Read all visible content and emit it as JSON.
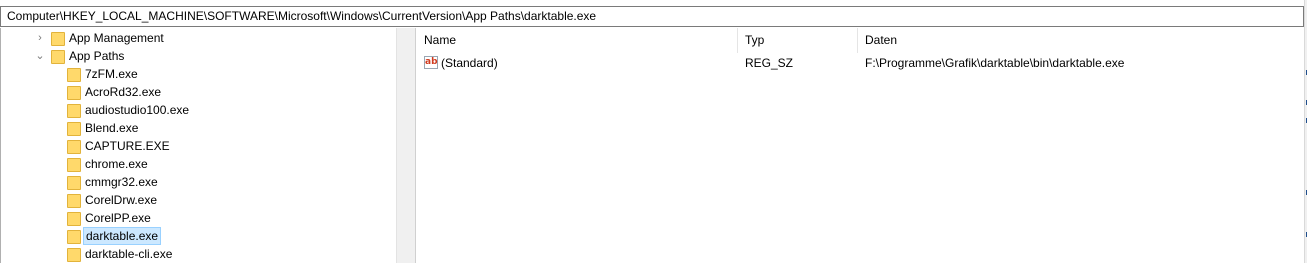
{
  "address_bar": {
    "path": "Computer\\HKEY_LOCAL_MACHINE\\SOFTWARE\\Microsoft\\Windows\\CurrentVersion\\App Paths\\darktable.exe"
  },
  "tree": {
    "parent_sibling": {
      "label": "App Management",
      "expanded": false
    },
    "parent": {
      "label": "App Paths",
      "expanded": true
    },
    "children": [
      {
        "label": "7zFM.exe"
      },
      {
        "label": "AcroRd32.exe"
      },
      {
        "label": "audiostudio100.exe"
      },
      {
        "label": "Blend.exe"
      },
      {
        "label": "CAPTURE.EXE"
      },
      {
        "label": "chrome.exe"
      },
      {
        "label": "cmmgr32.exe"
      },
      {
        "label": "CorelDrw.exe"
      },
      {
        "label": "CorelPP.exe"
      },
      {
        "label": "darktable.exe",
        "selected": true
      },
      {
        "label": "darktable-cli.exe"
      }
    ]
  },
  "values": {
    "columns": {
      "name": "Name",
      "type": "Typ",
      "data": "Daten"
    },
    "rows": [
      {
        "icon": "string-value-icon",
        "icon_text": "ab",
        "name": "(Standard)",
        "type": "REG_SZ",
        "data": "F:\\Programme\\Grafik\\darktable\\bin\\darktable.exe"
      }
    ]
  },
  "colors": {
    "selection_bg": "#cce8ff",
    "selection_border": "#99d1ff",
    "folder_fill": "#ffd96b"
  }
}
